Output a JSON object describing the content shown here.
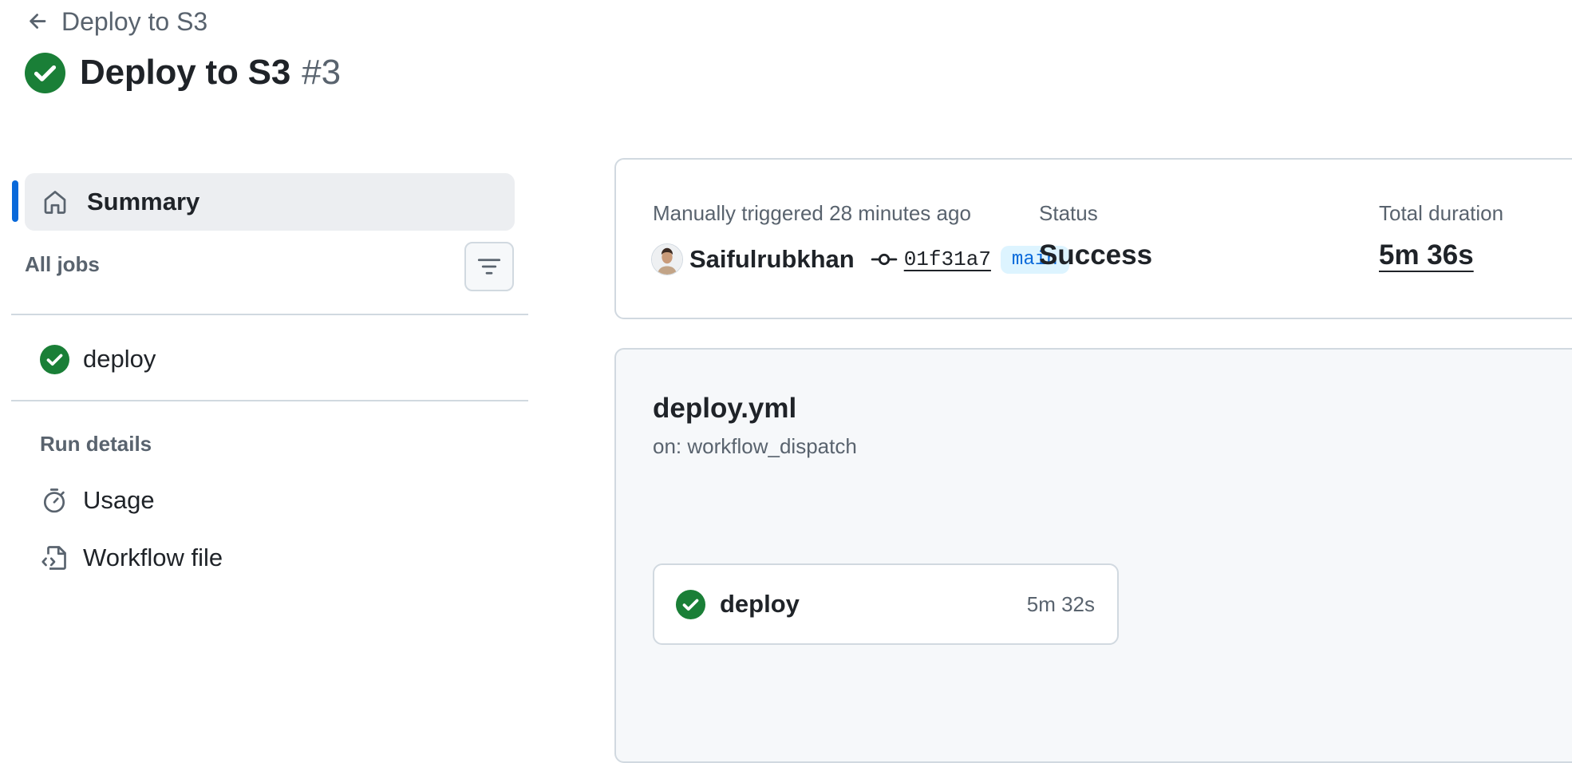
{
  "colors": {
    "success": "#1a7f37",
    "accent": "#0969da",
    "muted_text": "#59636e",
    "border": "#d1d9e0",
    "panel_bg": "#f6f8fa"
  },
  "header": {
    "back_label": "Deploy to S3",
    "back_icon": "arrow-left-icon",
    "title": "Deploy to S3",
    "run_number": "#3",
    "status_icon": "check-circle-fill-icon"
  },
  "sidebar": {
    "summary_label": "Summary",
    "summary_icon": "home-icon",
    "all_jobs_label": "All jobs",
    "filter_icon": "filter-icon",
    "jobs": [
      {
        "label": "deploy",
        "status_icon": "check-circle-fill-icon"
      }
    ],
    "run_details_label": "Run details",
    "details": [
      {
        "label": "Usage",
        "icon": "stopwatch-icon"
      },
      {
        "label": "Workflow file",
        "icon": "file-code-icon"
      }
    ]
  },
  "summary": {
    "trigger_text": "Manually triggered 28 minutes ago",
    "actor": "Saifulrubkhan",
    "commit_sha": "01f31a7",
    "commit_icon": "git-commit-icon",
    "branch": "main",
    "status_label": "Status",
    "status_value": "Success",
    "duration_label": "Total duration",
    "duration_value": "5m 36s"
  },
  "graph": {
    "file_name": "deploy.yml",
    "trigger": "on: workflow_dispatch",
    "job": {
      "name": "deploy",
      "duration": "5m 32s",
      "status_icon": "check-circle-fill-icon"
    }
  }
}
